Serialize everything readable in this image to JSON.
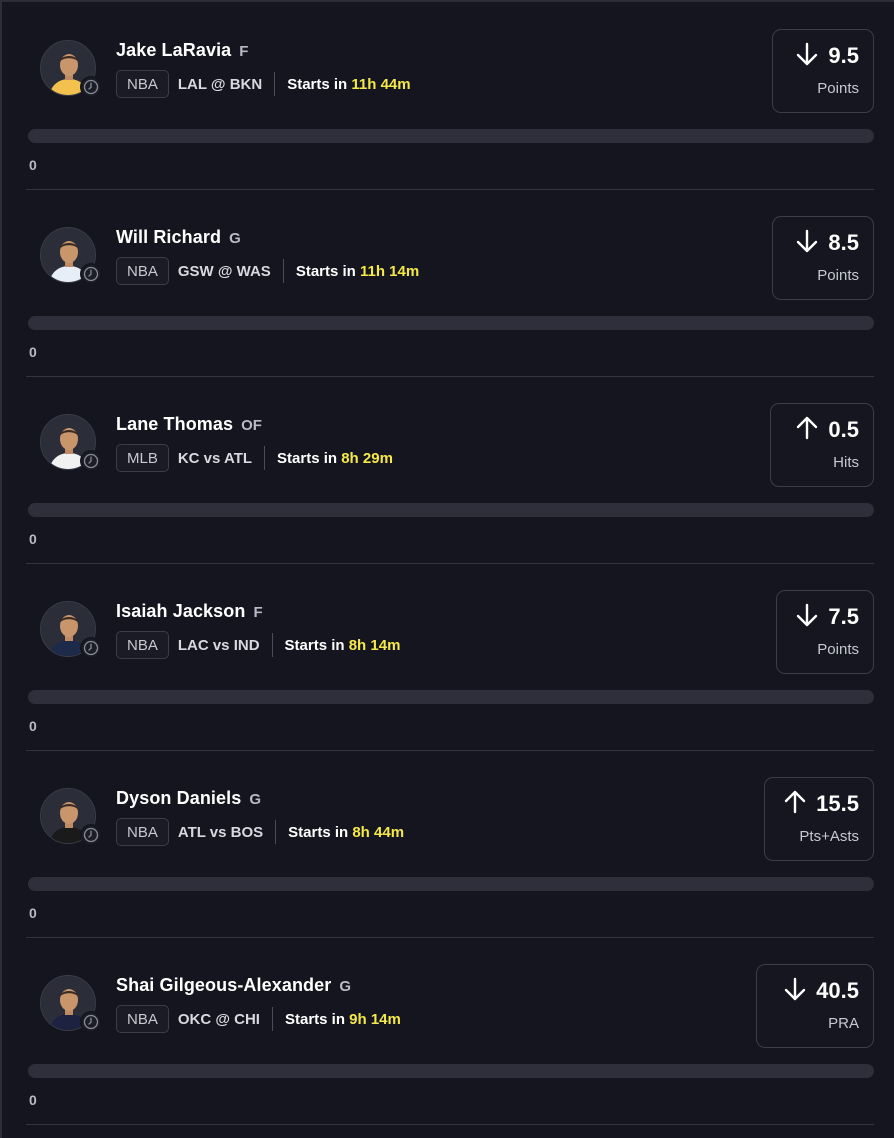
{
  "colors": {
    "background": "#14151e",
    "accent_time": "#f5e94a",
    "border": "#3b3d4a"
  },
  "projections": [
    {
      "player": "Jake LaRavia",
      "position": "F",
      "league": "NBA",
      "matchup": "LAL @ BKN",
      "starts_prefix": "Starts in",
      "starts_time": "11h 44m",
      "direction": "down",
      "direction_icon": "arrow-down-icon",
      "line": "9.5",
      "stat": "Points",
      "progress": 0,
      "progress_label": "0",
      "jersey_color": "#f2c14e"
    },
    {
      "player": "Will Richard",
      "position": "G",
      "league": "NBA",
      "matchup": "GSW @ WAS",
      "starts_prefix": "Starts in",
      "starts_time": "11h 14m",
      "direction": "down",
      "direction_icon": "arrow-down-icon",
      "line": "8.5",
      "stat": "Points",
      "progress": 0,
      "progress_label": "0",
      "jersey_color": "#e8eef8"
    },
    {
      "player": "Lane Thomas",
      "position": "OF",
      "league": "MLB",
      "matchup": "KC vs ATL",
      "starts_prefix": "Starts in",
      "starts_time": "8h 29m",
      "direction": "up",
      "direction_icon": "arrow-up-icon",
      "line": "0.5",
      "stat": "Hits",
      "progress": 0,
      "progress_label": "0",
      "jersey_color": "#f2f2f2"
    },
    {
      "player": "Isaiah Jackson",
      "position": "F",
      "league": "NBA",
      "matchup": "LAC vs IND",
      "starts_prefix": "Starts in",
      "starts_time": "8h 14m",
      "direction": "down",
      "direction_icon": "arrow-down-icon",
      "line": "7.5",
      "stat": "Points",
      "progress": 0,
      "progress_label": "0",
      "jersey_color": "#1d2a4a"
    },
    {
      "player": "Dyson Daniels",
      "position": "G",
      "league": "NBA",
      "matchup": "ATL vs BOS",
      "starts_prefix": "Starts in",
      "starts_time": "8h 44m",
      "direction": "up",
      "direction_icon": "arrow-up-icon",
      "line": "15.5",
      "stat": "Pts+Asts",
      "progress": 0,
      "progress_label": "0",
      "jersey_color": "#1a1a1a"
    },
    {
      "player": "Shai Gilgeous-Alexander",
      "position": "G",
      "league": "NBA",
      "matchup": "OKC @ CHI",
      "starts_prefix": "Starts in",
      "starts_time": "9h 14m",
      "direction": "down",
      "direction_icon": "arrow-down-icon",
      "line": "40.5",
      "stat": "PRA",
      "progress": 0,
      "progress_label": "0",
      "jersey_color": "#1c2240"
    }
  ]
}
